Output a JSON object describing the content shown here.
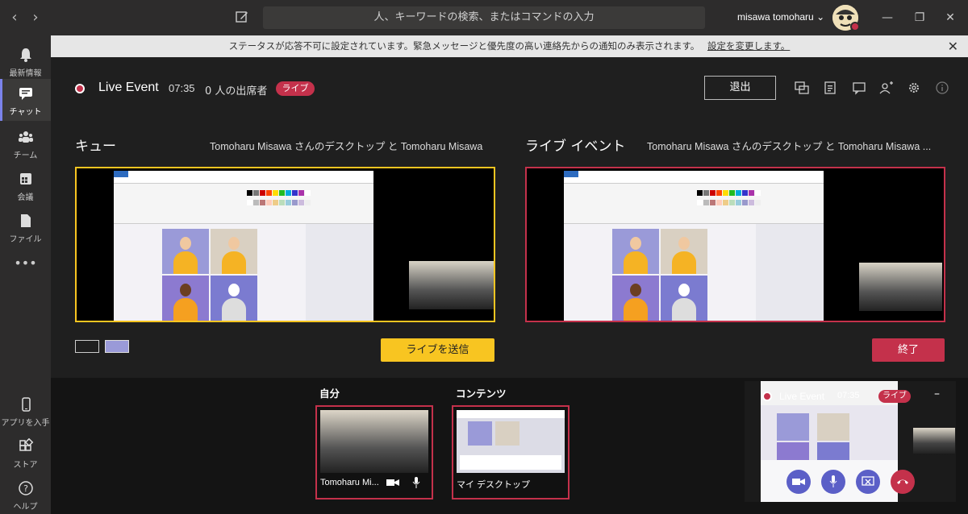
{
  "topbar": {
    "back_icon": "chevron-left-icon",
    "forward_icon": "chevron-right-icon",
    "search_placeholder": "人、キーワードの検索、またはコマンドの入力",
    "username": "misawa tomoharu",
    "username_chevron": "⌄"
  },
  "sidebar": {
    "items": [
      {
        "label": "最新情報",
        "icon": "bell-icon"
      },
      {
        "label": "チャット",
        "icon": "chat-icon",
        "active": true
      },
      {
        "label": "チーム",
        "icon": "teams-icon"
      },
      {
        "label": "会議",
        "icon": "calendar-icon"
      },
      {
        "label": "ファイル",
        "icon": "file-icon"
      },
      {
        "label": "•••",
        "icon": "more-icon"
      }
    ],
    "bottom_items": [
      {
        "label": "アプリを入手",
        "icon": "phone-icon"
      },
      {
        "label": "ストア",
        "icon": "store-icon"
      },
      {
        "label": "ヘルプ",
        "icon": "help-icon"
      }
    ]
  },
  "banner": {
    "text": "ステータスが応答不可に設定されています。緊急メッセージと優先度の高い連絡先からの通知のみ表示されます。",
    "link": "設定を変更します。"
  },
  "meeting": {
    "title": "Live Event",
    "elapsed": "07:35",
    "attendees": "0 人の出席者",
    "live_badge": "ライブ",
    "leave_label": "退出"
  },
  "queue": {
    "title": "キュー",
    "source": "Tomoharu Misawa さんのデスクトップ と Tomoharu Misawa",
    "send_label": "ライブを送信"
  },
  "live": {
    "title": "ライブ イベント",
    "source": "Tomoharu Misawa さんのデスクトップ と Tomoharu Misawa ...",
    "end_label": "終了"
  },
  "strip": {
    "self_label": "自分",
    "content_label": "コンテンツ",
    "self_tile_name": "Tomoharu Mi...",
    "content_tile_name": "マイ デスクトップ"
  },
  "mini": {
    "title": "Live Event",
    "elapsed": "07:35",
    "badge": "ライブ",
    "minimize": "–"
  },
  "colors": {
    "accent_queue": "#f8c521",
    "accent_live": "#c4314b",
    "sidebar_accent": "#7b83eb"
  }
}
